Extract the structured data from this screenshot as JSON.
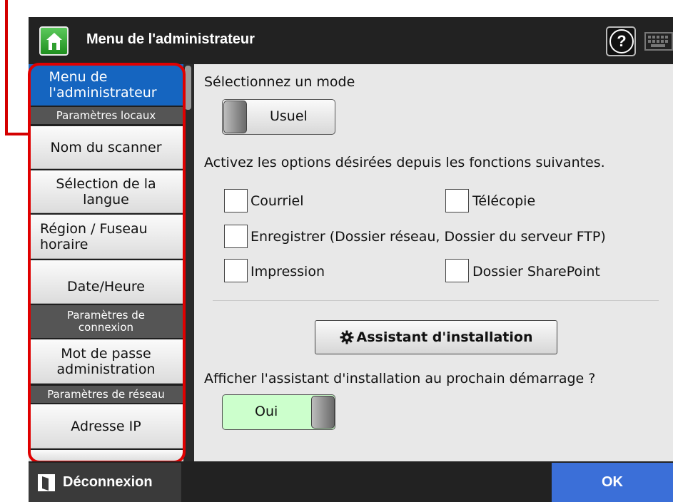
{
  "header": {
    "title": "Menu de l'administrateur",
    "help_label": "?",
    "home_icon": "home-icon",
    "keyboard_icon": "keyboard-icon"
  },
  "sidebar": {
    "active_item": "Menu de l'administrateur",
    "sections": [
      "Paramètres locaux",
      "Paramètres de connexion",
      "Paramètres de réseau"
    ],
    "items": [
      "Nom du scanner",
      "Sélection de la langue",
      "Région / Fuseau horaire",
      "Date/Heure",
      "Mot de passe administration",
      "Adresse IP"
    ]
  },
  "main": {
    "mode_prompt": "Sélectionnez un mode",
    "mode_value": "Usuel",
    "options_prompt": "Activez les options désirées depuis les fonctions suivantes.",
    "options": [
      {
        "label": "Courriel",
        "checked": false
      },
      {
        "label": "Télécopie",
        "checked": false
      },
      {
        "label": "Enregistrer (Dossier réseau, Dossier du serveur FTP)",
        "checked": false
      },
      {
        "label": "Impression",
        "checked": false
      },
      {
        "label": "Dossier SharePoint",
        "checked": false
      }
    ],
    "wizard_button": "Assistant d'installation",
    "wizard_icon": "gear-icon",
    "startup_prompt": "Afficher l'assistant d'installation au prochain démarrage ?",
    "startup_value": "Oui"
  },
  "footer": {
    "logout_label": "Déconnexion",
    "logout_icon": "logout-icon",
    "ok_label": "OK"
  },
  "colors": {
    "header_bg": "#222222",
    "active_item": "#1565c0",
    "highlight_frame": "#e00000",
    "ok_button": "#3b6fd8",
    "toggle_on": "#ccffcc"
  }
}
